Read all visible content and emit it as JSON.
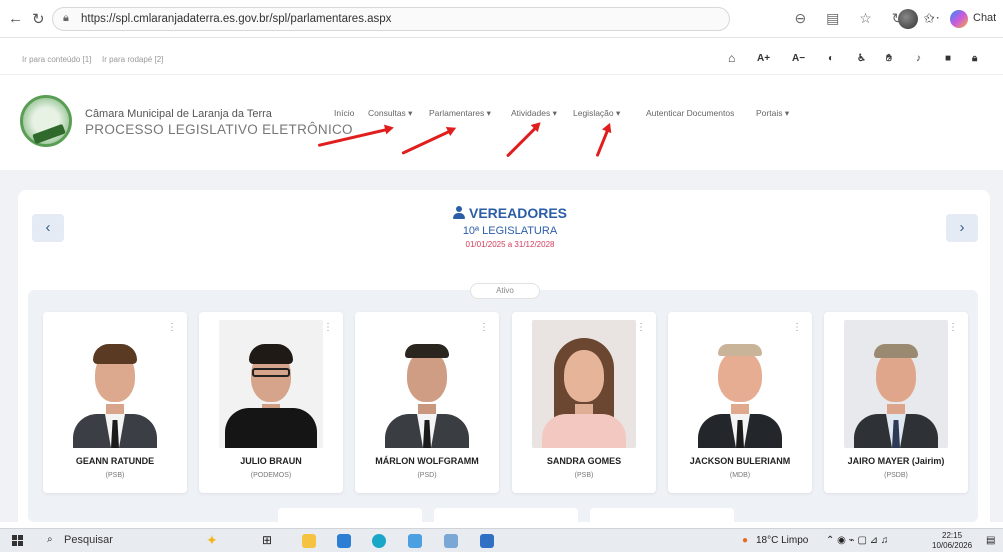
{
  "browser": {
    "url": "https://spl.cmlaranjadaterra.es.gov.br/spl/parlamentares.aspx",
    "chat_label": "Chat"
  },
  "skip_links": [
    "Ir para conteúdo [1]",
    "Ir para rodapé [2]"
  ],
  "accessibility": [
    "A+",
    "A−"
  ],
  "site": {
    "title": "Câmara Municipal de Laranja da Terra",
    "subtitle": "PROCESSO LEGISLATIVO ELETRÔNICO",
    "menu": [
      "Início",
      "Consultas ▾",
      "Parlamentares ▾",
      "Atividades ▾",
      "Legislação ▾",
      "Autenticar Documentos",
      "Portais ▾"
    ]
  },
  "section": {
    "title": "VEREADORES",
    "legislature": "10ª LEGISLATURA",
    "period": "01/01/2025 a 31/12/2028",
    "status": "Ativo"
  },
  "councillors": [
    {
      "name": "GEANN RATUNDE",
      "party": "(PSB)"
    },
    {
      "name": "JULIO BRAUN",
      "party": "(PODEMOS)"
    },
    {
      "name": "MÁRLON WOLFGRAMM",
      "party": "(PSD)"
    },
    {
      "name": "SANDRA GOMES",
      "party": "(PSB)"
    },
    {
      "name": "JACKSON BULERIANM",
      "party": "(MDB)"
    },
    {
      "name": "JAIRO MAYER (Jairim)",
      "party": "(PSDB)"
    }
  ],
  "taskbar": {
    "search": "Pesquisar",
    "weather": "18°C  Limpo",
    "time": "22:15",
    "date": "10/06/2026"
  },
  "colors": {
    "accent": "#2c5ea8",
    "period": "#d33c5c",
    "arrow": "#e01e1e"
  }
}
